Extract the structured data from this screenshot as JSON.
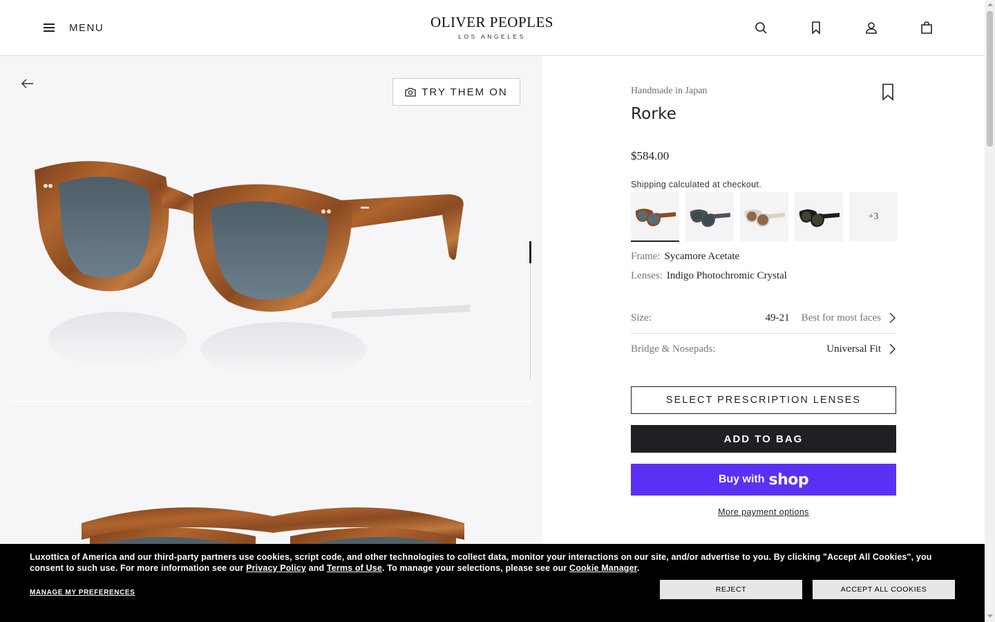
{
  "header": {
    "menu_label": "MENU",
    "brand": "OLIVER PEOPLES",
    "brand_sub": "LOS ANGELES",
    "icons": [
      "search-icon",
      "bookmark-icon",
      "account-icon",
      "bag-icon"
    ]
  },
  "gallery": {
    "try_on_label": "TRY THEM ON",
    "frame_color": "#8a4a22",
    "lens_color": "#5a6b76"
  },
  "product": {
    "origin": "Handmade in Japan",
    "name": "Rorke",
    "price": "$584.00",
    "shipping_prefix": "Shipping",
    "shipping_suffix": " calculated at checkout.",
    "swatches_more": "+3",
    "frame_label": "Frame:",
    "frame_value": "Sycamore Acetate",
    "lenses_label": "Lenses:",
    "lenses_value": "Indigo Photochromic Crystal",
    "size_label": "Size:",
    "size_value": "49-21",
    "size_hint": "Best for most faces",
    "bridge_label": "Bridge & Nosepads:",
    "bridge_value": "Universal Fit",
    "rx_button": "SELECT PRESCRIPTION LENSES",
    "add_button": "ADD TO BAG",
    "shop_pre": "Buy with",
    "shop_brand": "shop",
    "more_payment": "More payment options"
  },
  "cookie": {
    "text_1": "Luxottica of America and our third-party partners use cookies, script code, and other technologies to collect data, monitor your interactions on our site, and/or advertise to you. By clicking \"Accept All Cookies\", you consent to such use. For more information see our ",
    "privacy_link": "Privacy Policy",
    "and": " and ",
    "terms_link": "Terms of Use",
    "text_2": ". To manage your selections, please see our ",
    "manager_link": "Cookie Manager",
    "text_3": ".",
    "prefs": "MANAGE MY PREFERENCES",
    "reject": "REJECT",
    "accept": "ACCEPT ALL COOKIES"
  }
}
